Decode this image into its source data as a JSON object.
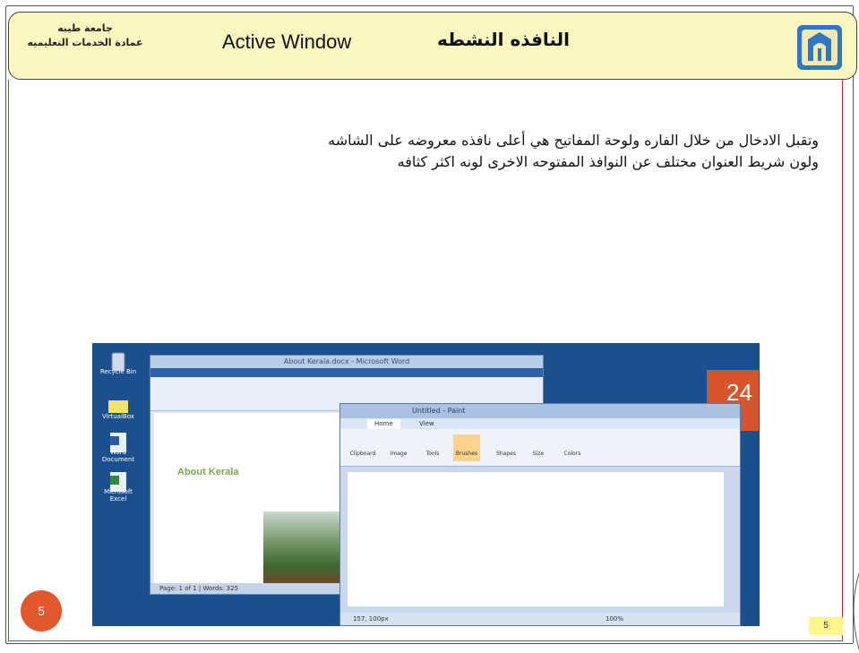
{
  "header": {
    "university": "جامعة طيبه",
    "deanship": "عمادة الخدمات التعليميه",
    "title_en": "Active Window",
    "title_ar": "النافذه النشطه",
    "logo_icon": "university-logo-icon"
  },
  "body": {
    "line1": "وتقبل الادخال من خلال الفاره ولوحة المفاتيح  هي أعلى نافذه معروضه على الشاشه",
    "line2": "ولون شريط العنوان مختلف عن النوافذ المفتوحه الاخرى لونه اكثر كثافه"
  },
  "screenshot": {
    "desktop_icons": [
      "Recycle Bin",
      "VirtualBox",
      "Word Document",
      "Microsoft Excel"
    ],
    "word": {
      "title": "About Kerala.docx - Microsoft Word",
      "heading": "About Kerala",
      "status": "Page: 1 of 1  |  Words: 325"
    },
    "paint": {
      "title": "Untitled - Paint",
      "tabs": [
        "Home",
        "View"
      ],
      "buttons": [
        "Clipboard",
        "Image",
        "Tools",
        "Brushes",
        "Shapes",
        "Size",
        "Colors"
      ],
      "status": "157, 100px",
      "zoom": "100%"
    },
    "calendar_widget": "24"
  },
  "footer": {
    "circle_number": "5",
    "slide_number": "5"
  },
  "colors": {
    "header_bg": "#fbf6bf",
    "accent_orange": "#e2572b",
    "page_num_bg": "#fdf58e",
    "content_border": "#cc3333"
  }
}
